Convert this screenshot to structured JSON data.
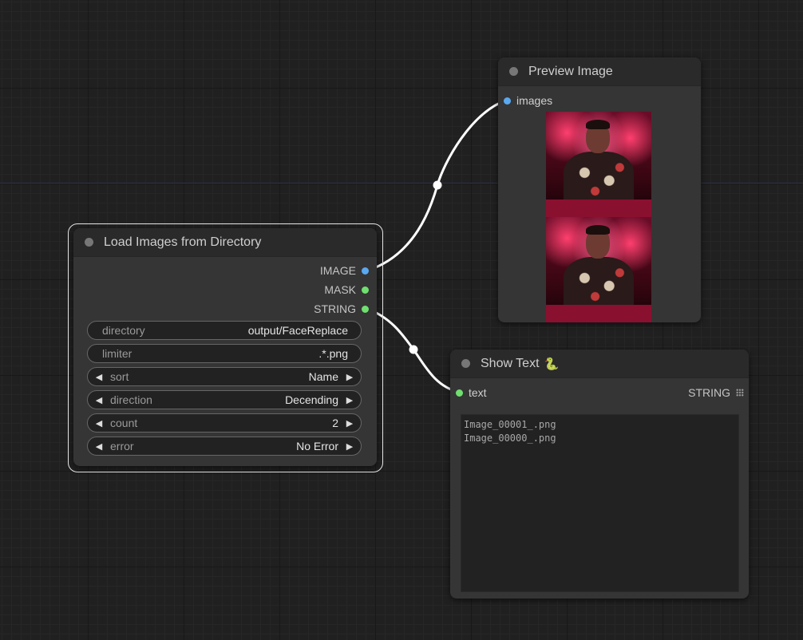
{
  "load_node": {
    "title": "Load Images from Directory",
    "outputs": [
      {
        "label": "IMAGE",
        "color": "#5aa9f0"
      },
      {
        "label": "MASK",
        "color": "#6fe06f"
      },
      {
        "label": "STRING",
        "color": "#6fe06f"
      }
    ],
    "widgets": {
      "directory": {
        "label": "directory",
        "value": "output/FaceReplace"
      },
      "limiter": {
        "label": "limiter",
        "value": ".*.png"
      },
      "sort": {
        "label": "sort",
        "value": "Name"
      },
      "direction": {
        "label": "direction",
        "value": "Decending"
      },
      "count": {
        "label": "count",
        "value": "2"
      },
      "error": {
        "label": "error",
        "value": "No Error"
      }
    }
  },
  "preview_node": {
    "title": "Preview Image",
    "input_label": "images"
  },
  "text_node": {
    "title": "Show Text",
    "title_icon": "🐍",
    "input_label": "text",
    "output_label": "STRING",
    "lines": [
      "Image_00001_.png",
      "Image_00000_.png"
    ]
  },
  "colors": {
    "image_slot": "#5aa9f0",
    "string_slot": "#6fe06f",
    "wire": "#ffffff",
    "node_bg": "#353535"
  }
}
